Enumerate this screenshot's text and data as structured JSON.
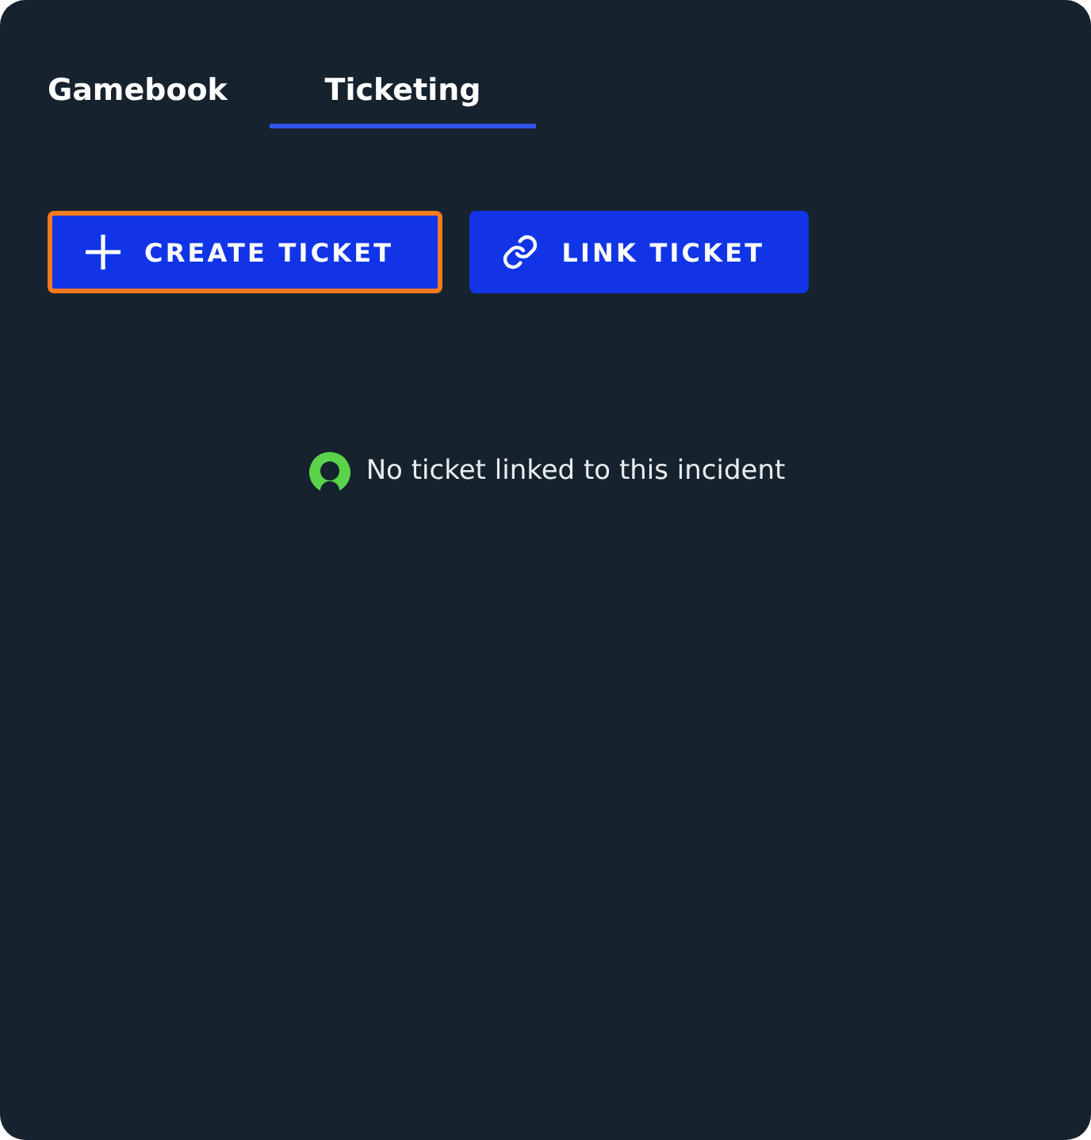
{
  "tabs": [
    {
      "label": "Gamebook",
      "selected": false
    },
    {
      "label": "Ticketing",
      "selected": true
    }
  ],
  "actions": [
    {
      "label": "CREATE TICKET",
      "kind": "create",
      "focused": true
    },
    {
      "label": "LINK TICKET",
      "kind": "link",
      "focused": false
    }
  ],
  "empty_state": {
    "message": "No ticket linked to this incident"
  }
}
